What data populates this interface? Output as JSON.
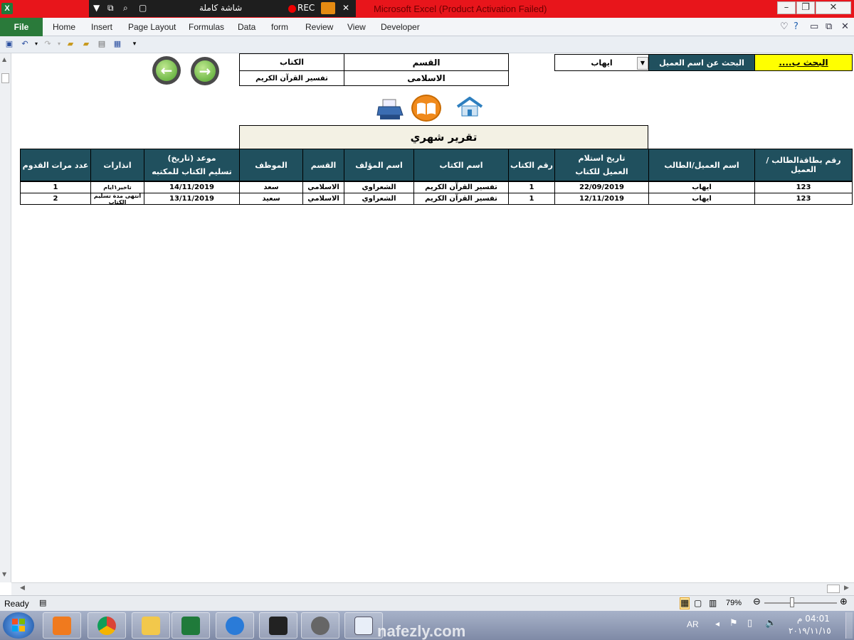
{
  "window": {
    "title": "Microsoft Excel (Product Activation Failed)",
    "recorder": {
      "fullscreen": "شاشة كاملة",
      "rec": "REC"
    }
  },
  "ribbon": {
    "file": "File",
    "tabs": [
      "Home",
      "Insert",
      "Page Layout",
      "Formulas",
      "Data",
      "form",
      "Review",
      "View",
      "Developer"
    ]
  },
  "search": {
    "by_label": "البحث ب....",
    "client_label": "البحث عن اسم العميل",
    "client_value": "ايهاب"
  },
  "info": {
    "book_label": "الكتاب",
    "section_label": "القسم",
    "book_value": "تفسير القرآن الكريم",
    "section_value": "الاسلامى"
  },
  "report_title": "تقرير شهري",
  "table": {
    "headers": [
      {
        "line1": "رقم بطاقةالطالب /العميل",
        "line2": ""
      },
      {
        "line1": "اسم العميل/الطالب",
        "line2": ""
      },
      {
        "line1": "تاريخ استلام",
        "line2": "العميل للكتاب"
      },
      {
        "line1": "رقم الكتاب",
        "line2": ""
      },
      {
        "line1": "اسم الكتاب",
        "line2": ""
      },
      {
        "line1": "اسم المؤلف",
        "line2": ""
      },
      {
        "line1": "القسم",
        "line2": ""
      },
      {
        "line1": "الموظف",
        "line2": ""
      },
      {
        "line1": "موعد (تاريخ)",
        "line2": "تسليم الكتاب للمكتبه"
      },
      {
        "line1": "انذارات",
        "line2": ""
      },
      {
        "line1": "عدد مرات القدوم",
        "line2": ""
      }
    ],
    "rows": [
      [
        "123",
        "ايهاب",
        "22/09/2019",
        "1",
        "تفسير القرآن الكريم",
        "الشعراوي",
        "الاسلامي",
        "سعد",
        "14/11/2019",
        "تاخير١ايام",
        "1"
      ],
      [
        "123",
        "ايهاب",
        "12/11/2019",
        "1",
        "تفسير القرآن الكريم",
        "الشعراوي",
        "الاسلامي",
        "سعيد",
        "13/11/2019",
        "انتهى مدة تسليم الكتاب",
        "2"
      ]
    ]
  },
  "status": {
    "ready": "Ready",
    "zoom": "79%"
  },
  "taskbar": {
    "lang": "AR",
    "time": "04:01 م",
    "date": "٢٠١٩/١١/١٥",
    "watermark": "nafezly.com"
  },
  "colors": {
    "header_bg": "#20505e",
    "title_bar": "#e8151b",
    "search_yellow": "#ffff00"
  }
}
